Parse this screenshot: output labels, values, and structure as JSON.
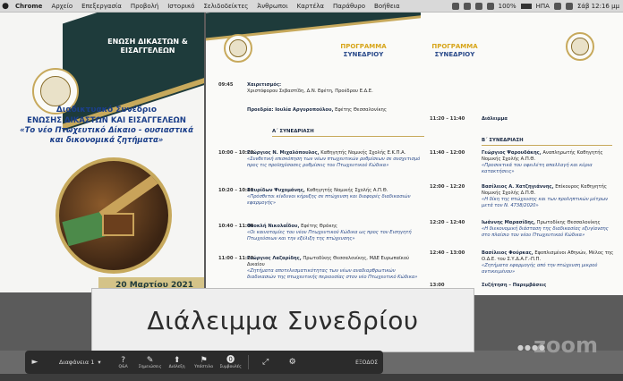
{
  "menubar": {
    "apple": "",
    "app": "Chrome",
    "items": [
      "Αρχείο",
      "Επεξεργασία",
      "Προβολή",
      "Ιστορικό",
      "Σελιδοδείκτες",
      "Άνθρωποι",
      "Καρτέλα",
      "Παράθυρο",
      "Βοήθεια"
    ],
    "battery": "100%",
    "battery_fraction": 1.0,
    "input": "ΗΠΑ",
    "clock": "Σάβ 12:16 μμ"
  },
  "left_slide": {
    "union": "ΕΝΩΣΗ ΔΙΚΑΣΤΩΝ & ΕΙΣΑΓΓΕΛΕΩΝ",
    "title_line1": "Διαδικτυακό Συνέδριο",
    "title_line2": "ΕΝΩΣΗΣ ΔΙΚΑΣΤΩΝ ΚΑΙ ΕΙΣΑΓΓΕΛΕΩΝ",
    "title_line3": "«Το νέο Πτωχευτικό Δίκαιο - ουσιαστικά και δικονομικά ζητήματα»",
    "date": "20 Μαρτίου 2021"
  },
  "right_slide": {
    "program_title": "ΠΡΟΓΡΑΜΜΑ",
    "program_sub": "ΣΥΝΕΔΡΙΟΥ",
    "col1": [
      {
        "time": "09:45",
        "text_bold": "Χαιρετισμός:",
        "text": "Χριστόφορου Σεβαστίδη, Δ.Ν. Εφέτη, Προέδρου Ε.Δ.Ε."
      },
      {
        "time": "",
        "text_bold": "Προεδρία: Ιουλία Αργυροπούλου,",
        "text": "Εφέτης Θεσσαλονίκης"
      },
      {
        "time": "",
        "section": "Α΄ ΣΥΝΕΔΡΙΑΣΗ"
      },
      {
        "time": "10:00 – 10:20",
        "text_bold": "Γεώργιος Ν. Μιχαλόπουλος,",
        "text": "Καθηγητής Νομικής Σχολής Ε.Κ.Π.Α.",
        "italic": "«Συνθετική επισκόπηση των νέων πτωχευτικών ρυθμίσεων σε συσχετισμό προς τις προϊσχύσασες ρυθμίσεις του Πτωχευτικού Κώδικα»"
      },
      {
        "time": "10:20 – 10:40",
        "text_bold": "Σπυρίδων Ψυχομάνης,",
        "text": "Καθηγητής Νομικής Σχολής Α.Π.Θ.",
        "italic": "«Πρόσθετοι κίνδυνοι κήρυξης σε πτώχευση και διαφορές διαδικασιών εφαρμογής»"
      },
      {
        "time": "10:40 – 11:00",
        "text_bold": "Θεοκλή Νικολαΐδου,",
        "text": "Εφέτης Θράκης",
        "italic": "«Οι καινοτομίες του νέου Πτωχευτικού Κώδικα ως προς τον Εισηγητή Πτωχεύσεων και την εξέλιξη της πτώχευσης»"
      },
      {
        "time": "11:00 – 11:20",
        "text_bold": "Γεώργιος Λαζαρίδης,",
        "text": "Πρωτοδίκης Θεσσαλονίκης, ΜΔΕ Ευρωπαϊκού Δικαίου",
        "italic": "«Ζητήματα αποτελεσματικότητας των νέων αναδιαρθρωτικών διαδικασιών της πτωχευτικής περιουσίας στον νέο Πτωχευτικό Κώδικα»"
      }
    ],
    "col2": [
      {
        "time": "11:20 – 11:40",
        "text_bold": "Διάλειμμα"
      },
      {
        "time": "",
        "section": "Β΄ ΣΥΝΕΔΡΙΑΣΗ"
      },
      {
        "time": "11:40 – 12:00",
        "text_bold": "Γεώργιος Ψαρουδάκης,",
        "text": "Αναπληρωτής Καθηγητής Νομικής Σχολής Α.Π.Θ.",
        "italic": "«Προσεκτικά του οφειλέτη απαλλαγή και κύρια κατακτήσεις»"
      },
      {
        "time": "12:00 – 12:20",
        "text_bold": "Βασίλειος Α. Χατζηγιάννης,",
        "text": "Επίκουρος Καθηγητής Νομικής Σχολής Δ.Π.Θ.",
        "italic": "«Η δίκη της πτώχευσης και των προληπτικών μέτρων μετά τον Ν. 4738/2020»"
      },
      {
        "time": "12:20 – 12:40",
        "text_bold": "Ιωάννης Μαρασίδης,",
        "text": "Πρωτοδίκης Θεσσαλονίκης",
        "italic": "«Η διεκονομική διάσταση της διαδικασίας εξυγίανσης στο πλαίσιο του νέου Πτωχευτικού Κώδικα»"
      },
      {
        "time": "12:40 – 13:00",
        "text_bold": "Βασίλειος Φούρκας,",
        "text": "Εφοπλισμένοι Αθηνών, Μέλος της Ο.Δ.Ε. του Σ.Υ.Δ.Α.Γ.-Π.Π.",
        "italic": "«Ζητήματα εφαρμογής από την πτώχευση μικρού αντικειμένου»"
      },
      {
        "time": "13:00",
        "text_bold": "Συζήτηση – Παρεμβάσεις"
      }
    ]
  },
  "banner": "Διάλειμμα Συνεδρίου",
  "toolbar": {
    "play": "►",
    "slide_select": "Διαφάνεια 1",
    "buttons": [
      {
        "glyph": "?",
        "label": "Q&A"
      },
      {
        "glyph": "✎",
        "label": "Σημειώσεις"
      },
      {
        "glyph": "⬆",
        "label": "Διάλεξη"
      },
      {
        "glyph": "⚑",
        "label": "Υπόστιλα"
      },
      {
        "glyph": "⓿",
        "label": "Συμβουλές"
      }
    ],
    "exit": "ΕΞΟΔΟΣ"
  },
  "zoom_logo": "zoom",
  "colors": {
    "gold": "#c7a95c",
    "navy": "#1e3b3b",
    "blue": "#1b3f8a",
    "orange": "#d7a51a"
  }
}
